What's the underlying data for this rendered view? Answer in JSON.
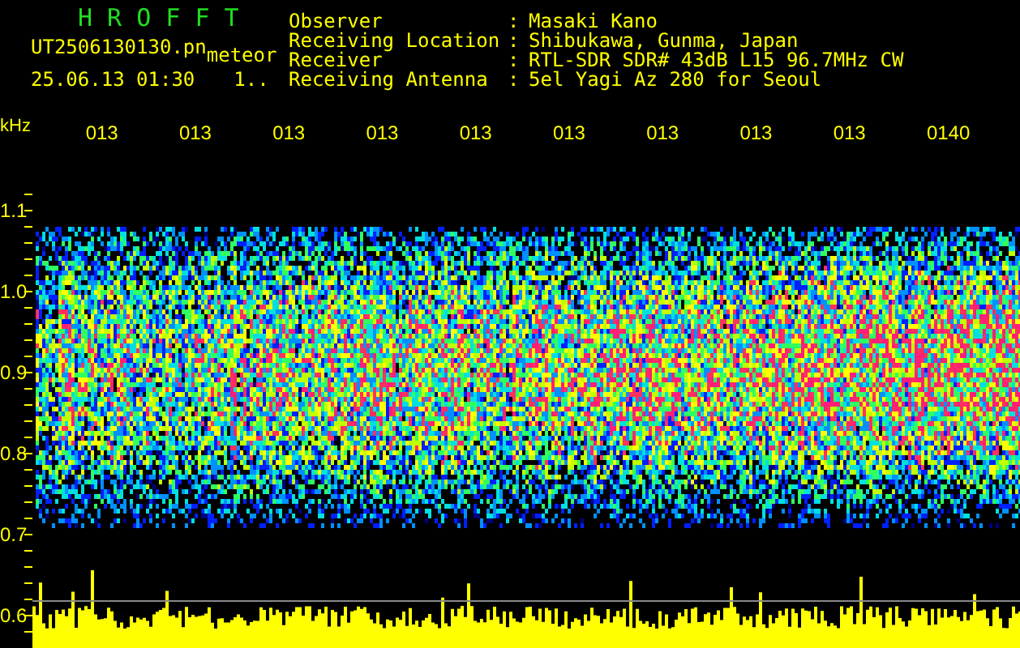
{
  "header": {
    "title": "H R O F F T",
    "filename": "UT2506130130.pn",
    "tag": "meteor",
    "timestamp": "25.06.13 01:30",
    "counter": "1.."
  },
  "info": [
    {
      "label": "Observer",
      "separator": ":",
      "value": "Masaki Kano"
    },
    {
      "label": "Receiving Location",
      "separator": ":",
      "value": "Shibukawa, Gunma, Japan"
    },
    {
      "label": "Receiver",
      "separator": ":",
      "value": "RTL-SDR SDR# 43dB L15 96.7MHz CW"
    },
    {
      "label": "Receiving Antenna",
      "separator": ":",
      "value": "5el Yagi Az 280 for Seoul"
    }
  ],
  "spectrogram": {
    "unit": "kHz",
    "time_labels": [
      "013",
      "013",
      "013",
      "013",
      "013",
      "013",
      "013",
      "013",
      "013",
      "0140"
    ],
    "freq_labels": [
      "1.1",
      "1.0",
      "0.9",
      "0.8",
      "0.7",
      "0.6"
    ]
  }
}
